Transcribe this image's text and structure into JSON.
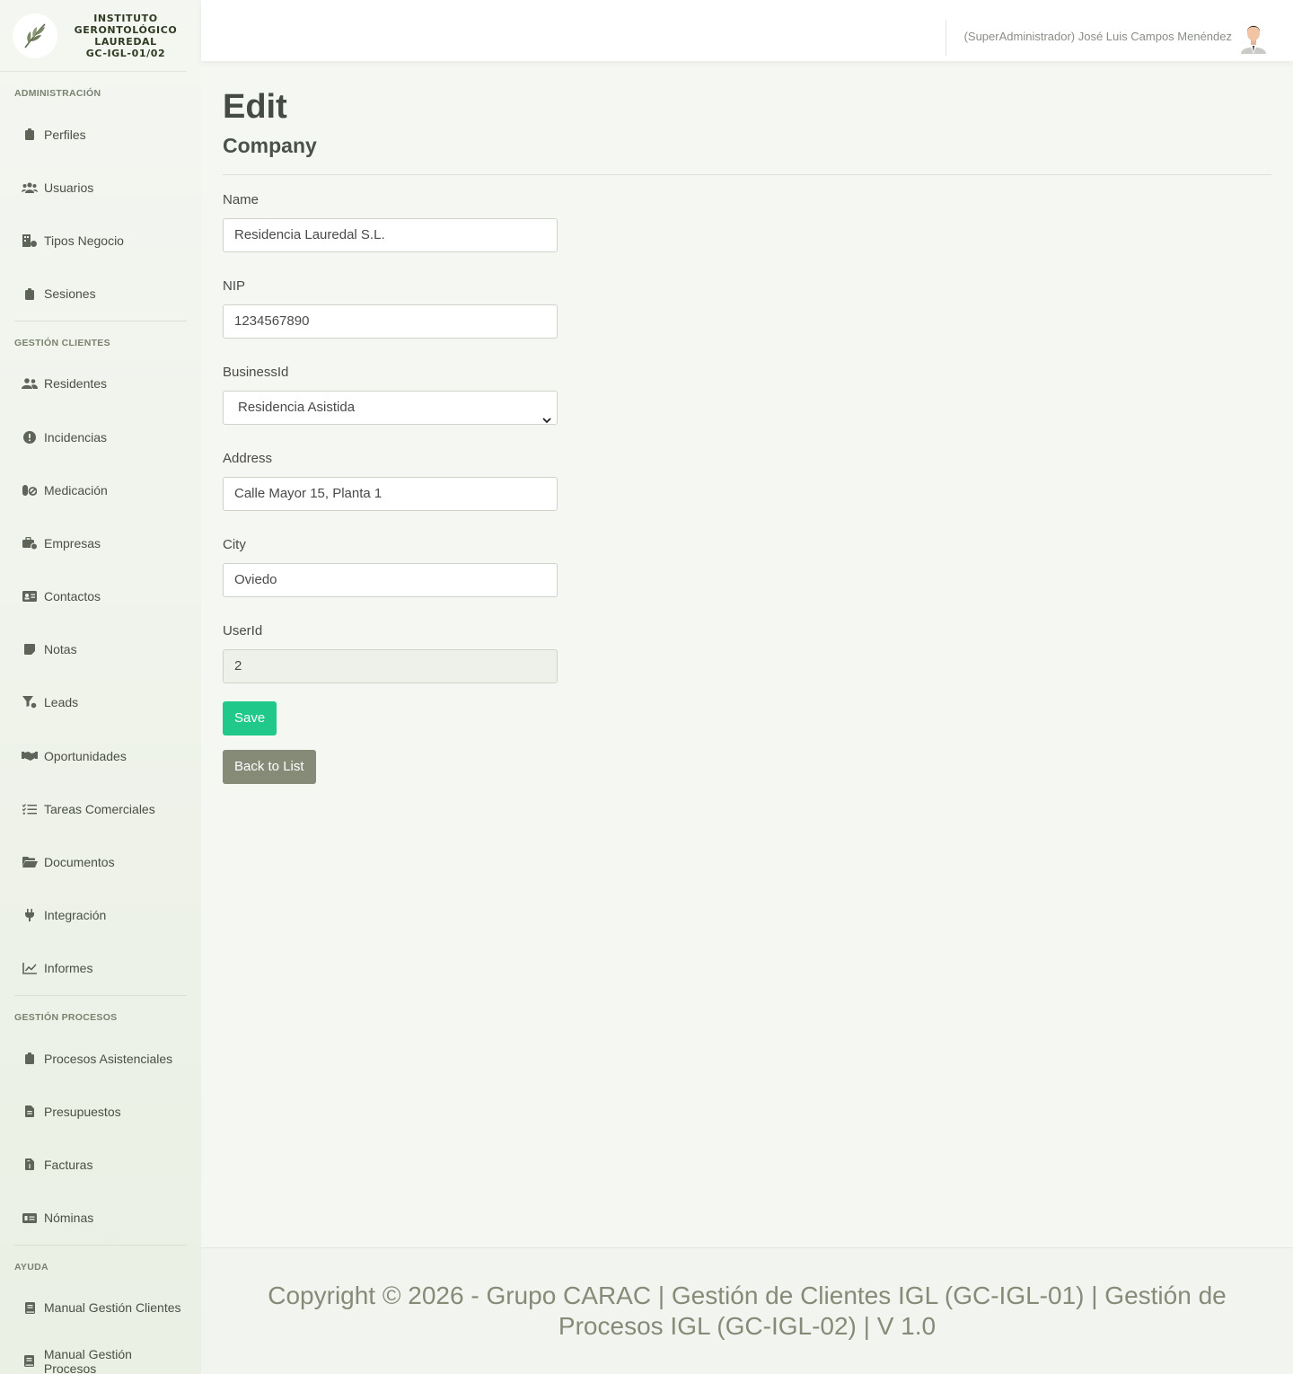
{
  "brand": {
    "line1": "INSTITUTO",
    "line2": "GERONTOLÓGICO",
    "line3": "LAUREDAL",
    "code": "GC-IGL-01/02"
  },
  "sidebar": {
    "sections": [
      {
        "heading": "ADMINISTRACIÓN",
        "items": [
          {
            "label": "Perfiles",
            "icon": "clipboard-icon"
          },
          {
            "label": "Usuarios",
            "icon": "users-icon"
          },
          {
            "label": "Tipos Negocio",
            "icon": "business-type-icon"
          },
          {
            "label": "Sesiones",
            "icon": "clipboard-icon"
          }
        ]
      },
      {
        "heading": "GESTIÓN CLIENTES",
        "items": [
          {
            "label": "Residentes",
            "icon": "user-group-icon"
          },
          {
            "label": "Incidencias",
            "icon": "alert-circle-icon"
          },
          {
            "label": "Medicación",
            "icon": "pills-icon"
          },
          {
            "label": "Empresas",
            "icon": "briefcase-icon"
          },
          {
            "label": "Contactos",
            "icon": "id-card-icon"
          },
          {
            "label": "Notas",
            "icon": "sticky-note-icon"
          },
          {
            "label": "Leads",
            "icon": "funnel-icon"
          },
          {
            "label": "Oportunidades",
            "icon": "handshake-icon"
          },
          {
            "label": "Tareas Comerciales",
            "icon": "task-list-icon"
          },
          {
            "label": "Documentos",
            "icon": "folder-open-icon"
          },
          {
            "label": "Integración",
            "icon": "plug-icon"
          },
          {
            "label": "Informes",
            "icon": "line-chart-icon"
          }
        ]
      },
      {
        "heading": "GESTIÓN PROCESOS",
        "items": [
          {
            "label": "Procesos Asistenciales",
            "icon": "clipboard-icon"
          },
          {
            "label": "Presupuestos",
            "icon": "file-text-icon"
          },
          {
            "label": "Facturas",
            "icon": "invoice-icon"
          },
          {
            "label": "Nóminas",
            "icon": "money-bill-icon"
          }
        ]
      },
      {
        "heading": "AYUDA",
        "items": [
          {
            "label": "Manual Gestión Clientes",
            "icon": "book-icon"
          },
          {
            "label": "Manual Gestión Procesos",
            "icon": "book-icon"
          }
        ]
      }
    ]
  },
  "topbar": {
    "user": "(SuperAdministrador) José Luis Campos Menéndez"
  },
  "page": {
    "title": "Edit",
    "subtitle": "Company"
  },
  "form": {
    "name_label": "Name",
    "name_value": "Residencia Lauredal S.L.",
    "nip_label": "NIP",
    "nip_value": "1234567890",
    "business_label": "BusinessId",
    "business_value": "Residencia Asistida",
    "address_label": "Address",
    "address_value": "Calle Mayor 15, Planta 1",
    "city_label": "City",
    "city_value": "Oviedo",
    "userid_label": "UserId",
    "userid_value": "2",
    "save_label": "Save",
    "back_label": "Back to List"
  },
  "footer": {
    "text": "Copyright © 2026 - Grupo CARAC | Gestión de Clientes IGL (GC-IGL-01) | Gestión de Procesos IGL (GC-IGL-02) | V 1.0"
  },
  "colors": {
    "accent": "#20c98a",
    "secondary": "#868b78",
    "brand_text": "#2f3b22"
  }
}
